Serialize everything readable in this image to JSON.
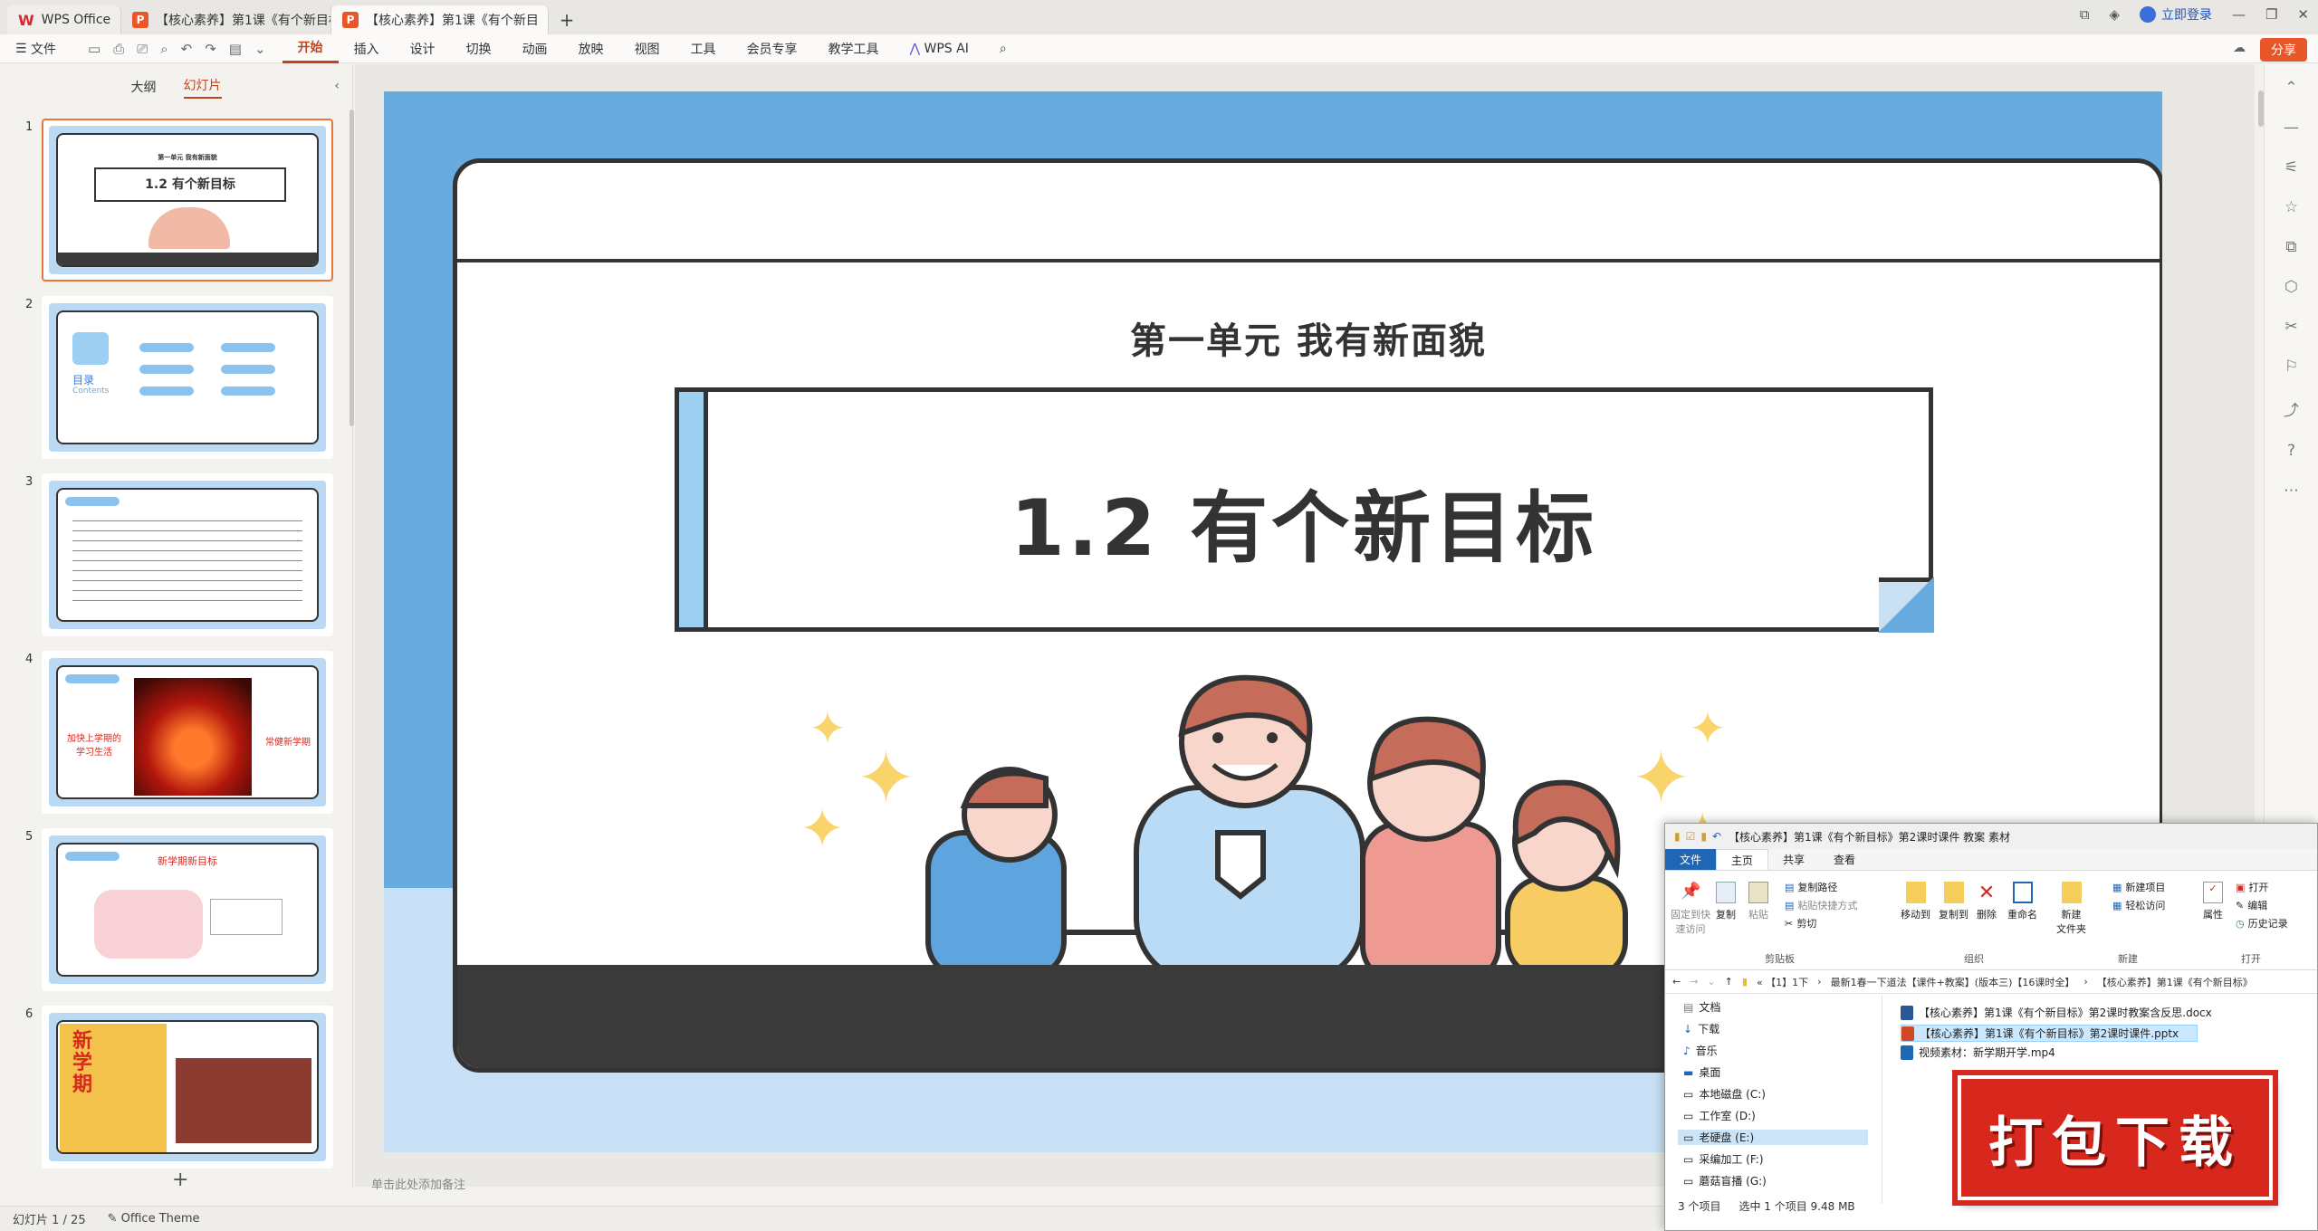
{
  "titlebar": {
    "tabs": [
      {
        "label": "WPS Office"
      },
      {
        "label": "【核心素养】第1课《有个新目标》第"
      },
      {
        "label": "【核心素养】第1课《有个新目"
      }
    ],
    "login": "立即登录"
  },
  "menubar": {
    "file": "文件",
    "items": [
      "开始",
      "插入",
      "设计",
      "切换",
      "动画",
      "放映",
      "视图",
      "工具",
      "会员专享",
      "教学工具"
    ],
    "ai": "WPS AI",
    "share": "分享"
  },
  "leftpanel": {
    "tab_outline": "大纲",
    "tab_slides": "幻灯片",
    "thumbs": [
      {
        "num": "1",
        "unit": "第一单元  我有新面貌",
        "title": "1.2  有个新目标"
      },
      {
        "num": "2",
        "toc": "目录",
        "toc_en": "Contents"
      },
      {
        "num": "3"
      },
      {
        "num": "4",
        "left": "加快上学期的学习生活",
        "right": "常健新学期"
      },
      {
        "num": "5",
        "title": "新学期新目标"
      },
      {
        "num": "6",
        "big": "新学期"
      }
    ],
    "add": "+"
  },
  "slide": {
    "unit_title": "第一单元   我有新面貌",
    "main_title": "1.2  有个新目标"
  },
  "notes": {
    "placeholder": "单击此处添加备注"
  },
  "statusbar": {
    "slide_count": "幻灯片 1 / 25",
    "theme": "Office Theme"
  },
  "explorer": {
    "title": "【核心素养】第1课《有个新目标》第2课时课件 教案 素材",
    "tabs": [
      "文件",
      "主页",
      "共享",
      "查看"
    ],
    "ribbon": {
      "pin": "固定到快\n速访问",
      "copy": "复制",
      "paste": "粘贴",
      "copy_path": "复制路径",
      "paste_shortcut": "粘贴快捷方式",
      "cut": "剪切",
      "group_clipboard": "剪贴板",
      "move_to": "移动到",
      "copy_to": "复制到",
      "delete": "删除",
      "rename": "重命名",
      "group_organize": "组织",
      "new_folder": "新建\n文件夹",
      "new_item": "新建项目",
      "easy_access": "轻松访问",
      "group_new": "新建",
      "properties": "属性",
      "open": "打开",
      "edit": "编辑",
      "history": "历史记录",
      "group_open": "打开"
    },
    "address": [
      "«  【1】1下",
      "最新1春一下道法【课件+教案】(版本三)【16课时全】",
      "【核心素养】第1课《有个新目标》"
    ],
    "nav": [
      {
        "label": "文档"
      },
      {
        "label": "下载"
      },
      {
        "label": "音乐"
      },
      {
        "label": "桌面"
      },
      {
        "label": "本地磁盘 (C:)"
      },
      {
        "label": "工作室 (D:)"
      },
      {
        "label": "老硬盘 (E:)"
      },
      {
        "label": "采编加工 (F:)"
      },
      {
        "label": "蘑菇盲播 (G:)"
      }
    ],
    "files": [
      {
        "name": "【核心素养】第1课《有个新目标》第2课时教案含反思.docx",
        "color": "#2b5797"
      },
      {
        "name": "【核心素养】第1课《有个新目标》第2课时课件.pptx",
        "color": "#d24726"
      },
      {
        "name": "视频素材：新学期开学.mp4",
        "color": "#1f66b5"
      }
    ],
    "status": {
      "count": "3 个项目",
      "selected": "选中 1 个项目  9.48 MB"
    }
  },
  "download_banner": "打包下载",
  "colors": {
    "accent": "#c0451f",
    "slide_bg": "#68abdf",
    "banner": "#d8281e"
  }
}
